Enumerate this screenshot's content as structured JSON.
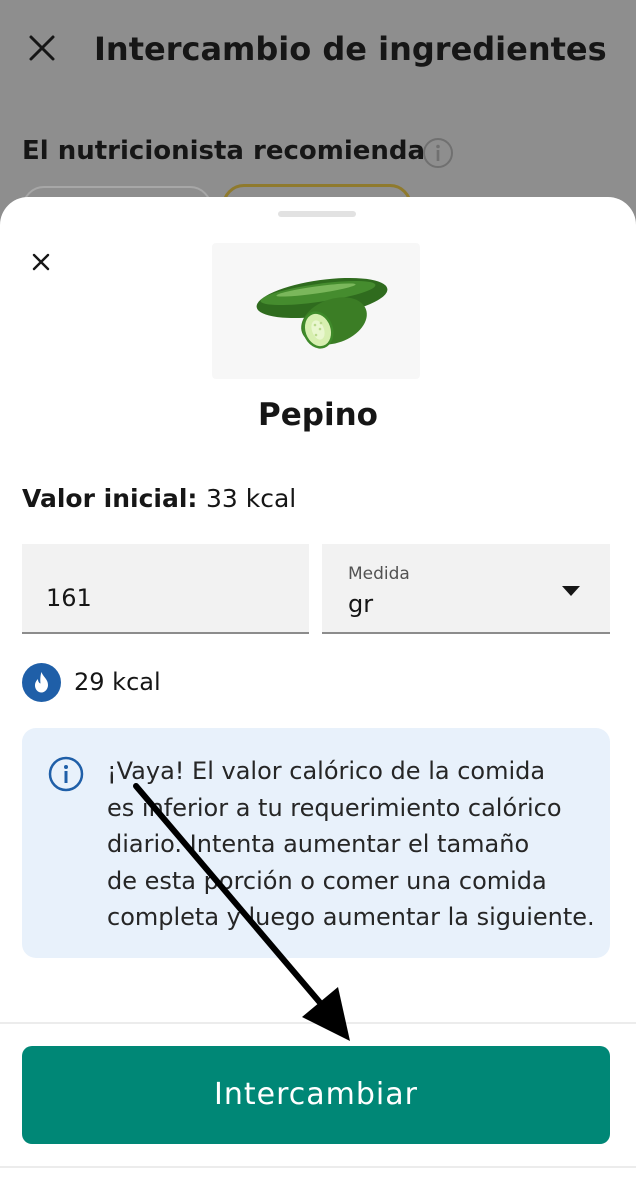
{
  "background": {
    "title": "Intercambio de ingredientes",
    "subtitle": "El nutricionista recomienda",
    "icons": {
      "close": "close-icon",
      "info": "info-icon"
    }
  },
  "sheet": {
    "icons": {
      "close": "close-icon"
    },
    "food": {
      "name": "Pepino",
      "image": "cucumber-image"
    },
    "initial_value": {
      "label": "Valor inicial:",
      "value": "33 kcal"
    },
    "quantity": {
      "value": "161"
    },
    "unit": {
      "label": "Medida",
      "selected": "gr"
    },
    "calories": {
      "icon": "flame-icon",
      "text": "29 kcal"
    },
    "notice": {
      "icon": "info-icon",
      "lines": [
        "¡Vaya! El valor calórico de la comida",
        "es inferior a tu requerimiento calórico",
        "diario. Intenta aumentar el tamaño",
        "de esta porción o comer una comida",
        "completa y luego aumentar la siguiente."
      ]
    },
    "action": {
      "label": "Intercambiar"
    }
  },
  "colors": {
    "accent": "#008776",
    "notice_bg": "#e8f1fb",
    "flame_badge": "#1f5fa8",
    "overlay": "#8e8e8e"
  }
}
